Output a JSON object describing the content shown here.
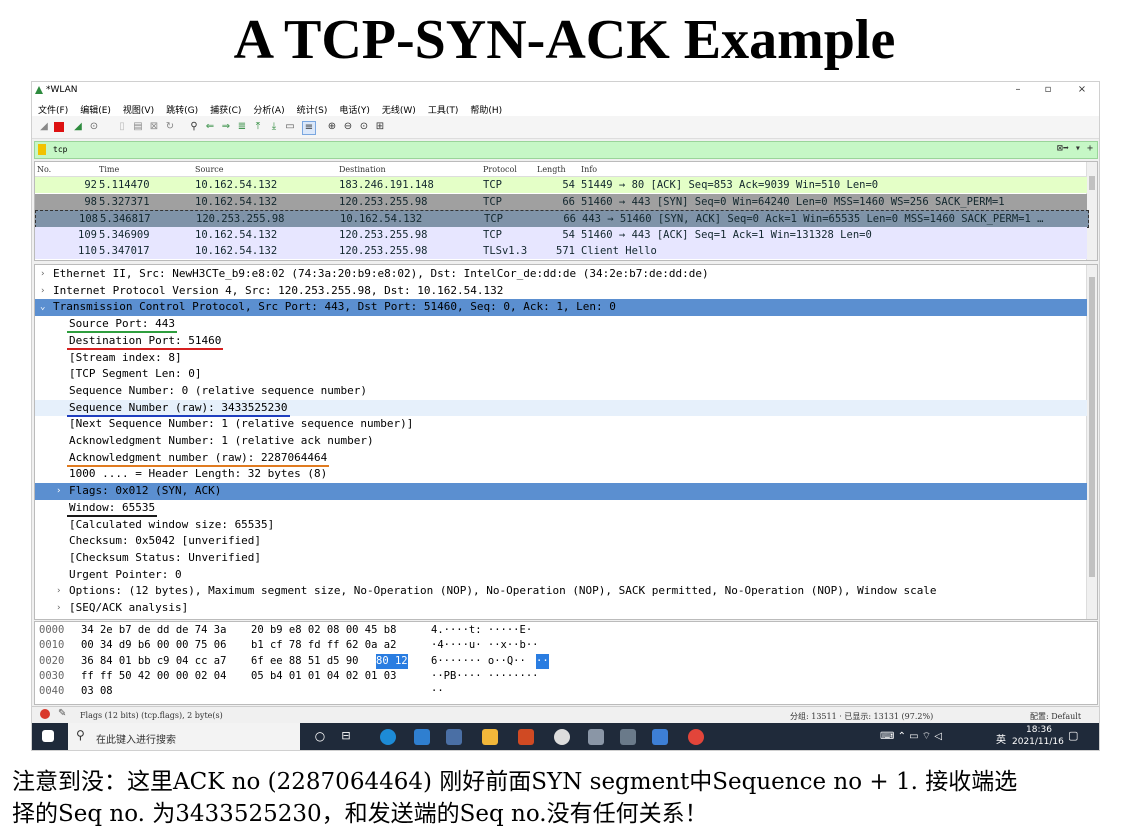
{
  "slide_title": "A TCP-SYN-ACK Example",
  "window": {
    "title": "*WLAN",
    "minimize": "–",
    "maximize": "▫",
    "close": "×"
  },
  "menu": [
    "文件(F)",
    "编辑(E)",
    "视图(V)",
    "跳转(G)",
    "捕获(C)",
    "分析(A)",
    "统计(S)",
    "电话(Y)",
    "无线(W)",
    "工具(T)",
    "帮助(H)"
  ],
  "filter": {
    "value": "tcp"
  },
  "packet_list": {
    "columns": [
      "No.",
      "Time",
      "Source",
      "Destination",
      "Protocol",
      "Length",
      "Info"
    ],
    "rows": [
      {
        "no": "92",
        "time": "5.114470",
        "src": "10.162.54.132",
        "dst": "183.246.191.148",
        "proto": "TCP",
        "len": "54",
        "info": "51449 → 80 [ACK] Seq=853 Ack=9039 Win=510 Len=0",
        "bg": "#e4ffc7",
        "fg": "#12272e"
      },
      {
        "no": "98",
        "time": "5.327371",
        "src": "10.162.54.132",
        "dst": "120.253.255.98",
        "proto": "TCP",
        "len": "66",
        "info": "51460 → 443 [SYN] Seq=0 Win=64240 Len=0 MSS=1460 WS=256 SACK_PERM=1",
        "bg": "#a0a0a0",
        "fg": "#12272e"
      },
      {
        "no": "108",
        "time": "5.346817",
        "src": "120.253.255.98",
        "dst": "10.162.54.132",
        "proto": "TCP",
        "len": "66",
        "info": "443 → 51460 [SYN, ACK] Seq=0 Ack=1 Win=65535 Len=0 MSS=1460 SACK_PERM=1 …",
        "bg": "#7f93a8",
        "fg": "#12272e"
      },
      {
        "no": "109",
        "time": "5.346909",
        "src": "10.162.54.132",
        "dst": "120.253.255.98",
        "proto": "TCP",
        "len": "54",
        "info": "51460 → 443 [ACK] Seq=1 Ack=1 Win=131328 Len=0",
        "bg": "#e7e6ff",
        "fg": "#12272e"
      },
      {
        "no": "110",
        "time": "5.347017",
        "src": "10.162.54.132",
        "dst": "120.253.255.98",
        "proto": "TLSv1.3",
        "len": "571",
        "info": "Client Hello",
        "bg": "#e7e6ff",
        "fg": "#12272e"
      }
    ]
  },
  "details": [
    {
      "indent": 0,
      "arrow": "›",
      "text": "Ethernet II, Src: NewH3CTe_b9:e8:02 (74:3a:20:b9:e8:02), Dst: IntelCor_de:dd:de (34:2e:b7:de:dd:de)",
      "style": "normal"
    },
    {
      "indent": 0,
      "arrow": "›",
      "text": "Internet Protocol Version 4, Src: 120.253.255.98, Dst: 10.162.54.132",
      "style": "normal"
    },
    {
      "indent": 0,
      "arrow": "⌄",
      "text": "Transmission Control Protocol, Src Port: 443, Dst Port: 51460, Seq: 0, Ack: 1, Len: 0",
      "style": "selected"
    },
    {
      "indent": 1,
      "arrow": "",
      "text": "Source Port: 443",
      "style": "normal",
      "underline": "#2e9e3e"
    },
    {
      "indent": 1,
      "arrow": "",
      "text": "Destination Port: 51460",
      "style": "normal",
      "underline": "#d62020"
    },
    {
      "indent": 1,
      "arrow": "",
      "text": "[Stream index: 8]",
      "style": "normal"
    },
    {
      "indent": 1,
      "arrow": "",
      "text": "[TCP Segment Len: 0]",
      "style": "normal"
    },
    {
      "indent": 1,
      "arrow": "",
      "text": "Sequence Number: 0    (relative sequence number)",
      "style": "normal"
    },
    {
      "indent": 1,
      "arrow": "",
      "text": "Sequence Number (raw): 3433525230",
      "style": "hover",
      "underline": "#1f3fbf"
    },
    {
      "indent": 1,
      "arrow": "",
      "text": "[Next Sequence Number: 1    (relative sequence number)]",
      "style": "normal"
    },
    {
      "indent": 1,
      "arrow": "",
      "text": "Acknowledgment Number: 1    (relative ack number)",
      "style": "normal"
    },
    {
      "indent": 1,
      "arrow": "",
      "text": "Acknowledgment number (raw): 2287064464",
      "style": "normal",
      "underline": "#e07b20"
    },
    {
      "indent": 1,
      "arrow": "",
      "text": "1000 .... = Header Length: 32 bytes (8)",
      "style": "normal"
    },
    {
      "indent": 1,
      "arrow": "›",
      "text": "Flags: 0x012 (SYN, ACK)",
      "style": "selected"
    },
    {
      "indent": 1,
      "arrow": "",
      "text": "Window: 65535",
      "style": "normal",
      "underline": "#1a1a1a"
    },
    {
      "indent": 1,
      "arrow": "",
      "text": "[Calculated window size: 65535]",
      "style": "normal"
    },
    {
      "indent": 1,
      "arrow": "",
      "text": "Checksum: 0x5042 [unverified]",
      "style": "normal"
    },
    {
      "indent": 1,
      "arrow": "",
      "text": "[Checksum Status: Unverified]",
      "style": "normal"
    },
    {
      "indent": 1,
      "arrow": "",
      "text": "Urgent Pointer: 0",
      "style": "normal"
    },
    {
      "indent": 1,
      "arrow": "›",
      "text": "Options: (12 bytes), Maximum segment size, No-Operation (NOP), No-Operation (NOP), SACK permitted, No-Operation (NOP), Window scale",
      "style": "normal"
    },
    {
      "indent": 1,
      "arrow": "›",
      "text": "[SEQ/ACK analysis]",
      "style": "normal"
    }
  ],
  "hex": [
    {
      "off": "0000",
      "a": "34 2e b7 de dd de 74 3a",
      "b": "20 b9 e8 02 08 00 45 b8",
      "ascii": "4.····t:  ·····E·"
    },
    {
      "off": "0010",
      "a": "00 34 d9 b6 00 00 75 06",
      "b": "b1 cf 78 fd ff 62 0a a2",
      "ascii": "·4····u·  ··x··b··"
    },
    {
      "off": "0020",
      "a": "36 84 01 bb c9 04 cc a7",
      "b": "6f ee 88 51 d5 90",
      "sel": "80 12",
      "ascii": "6······· o··Q··",
      "ascii_sel": "··"
    },
    {
      "off": "0030",
      "a": "ff ff 50 42 00 00 02 04",
      "b": "05 b4 01 01 04 02 01 03",
      "ascii": "··PB···· ········"
    },
    {
      "off": "0040",
      "a": "03 08",
      "b": "",
      "ascii": "··"
    }
  ],
  "status": {
    "left": "Flags (12 bits) (tcp.flags), 2 byte(s)",
    "middle": "分组: 13511 · 已显示: 13131 (97.2%)",
    "right": "配置: Default"
  },
  "taskbar": {
    "search_placeholder": "在此键入进行搜索",
    "lang": "英",
    "time": "18:36",
    "date": "2021/11/16"
  },
  "note": {
    "line1": "注意到没：这里ACK no (2287064464) 刚好前面SYN segment中Sequence no + 1. 接收端选",
    "line2": "择的Seq no. 为3433525230，和发送端的Seq no.没有任何关系！"
  }
}
